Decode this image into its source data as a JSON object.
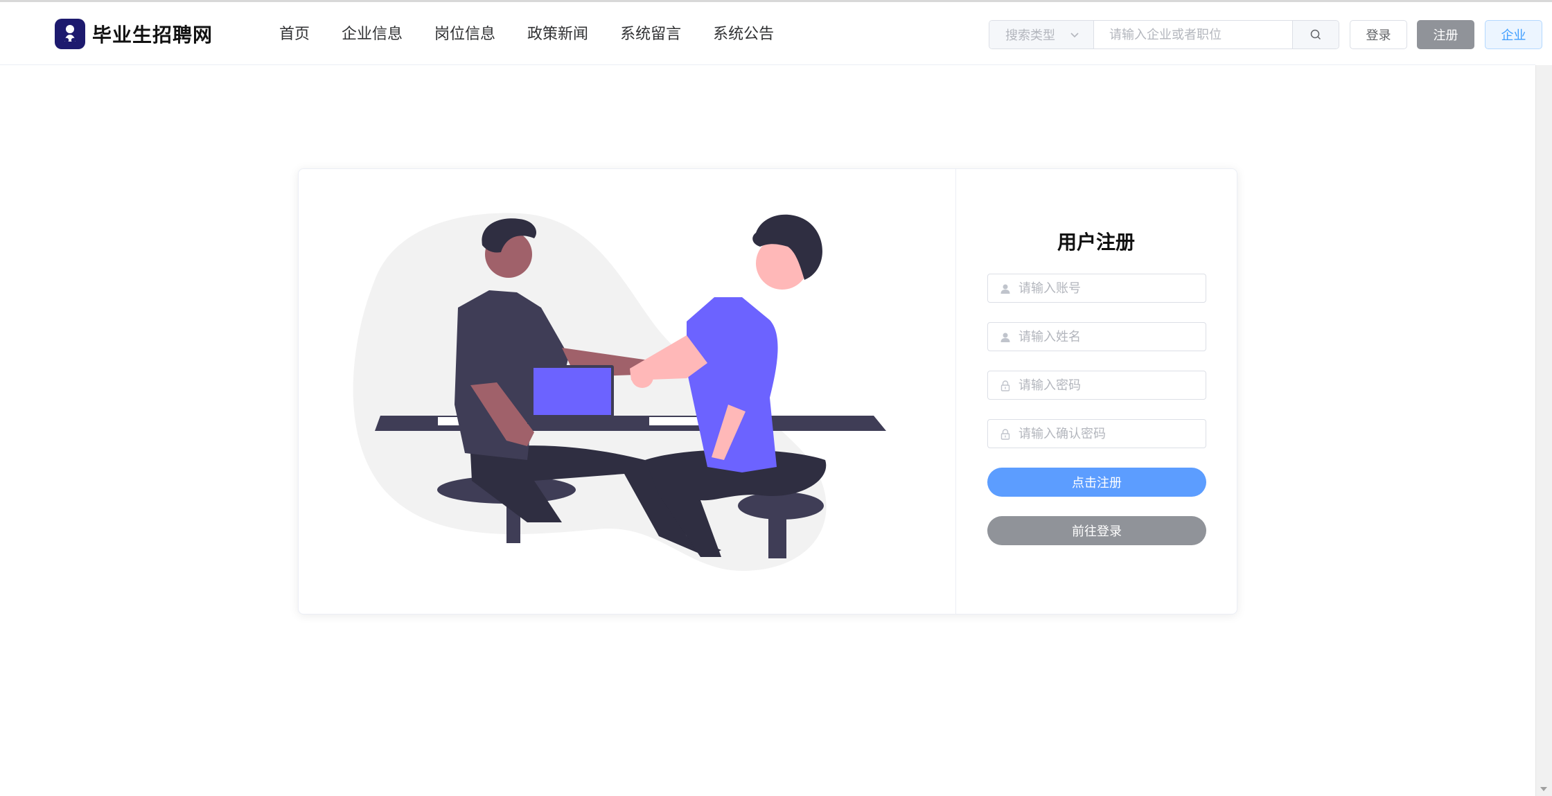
{
  "brand": {
    "name": "毕业生招聘网",
    "logo_color": "#1d1a6e"
  },
  "nav": {
    "items": [
      {
        "label": "首页"
      },
      {
        "label": "企业信息"
      },
      {
        "label": "岗位信息"
      },
      {
        "label": "政策新闻"
      },
      {
        "label": "系统留言"
      },
      {
        "label": "系统公告"
      }
    ]
  },
  "search": {
    "type_placeholder": "搜索类型",
    "placeholder": "请输入企业或者职位",
    "icon": "search-icon"
  },
  "header_buttons": {
    "login": "登录",
    "register": "注册",
    "company": "企业"
  },
  "register_form": {
    "title": "用户注册",
    "account_placeholder": "请输入账号",
    "name_placeholder": "请输入姓名",
    "password_placeholder": "请输入密码",
    "confirm_placeholder": "请输入确认密码",
    "submit_label": "点击注册",
    "goto_login_label": "前往登录"
  },
  "colors": {
    "primary": "#5c9dff",
    "gray_button": "#909399",
    "illustration_accent": "#6c63ff",
    "illustration_dark": "#2f2e41"
  }
}
